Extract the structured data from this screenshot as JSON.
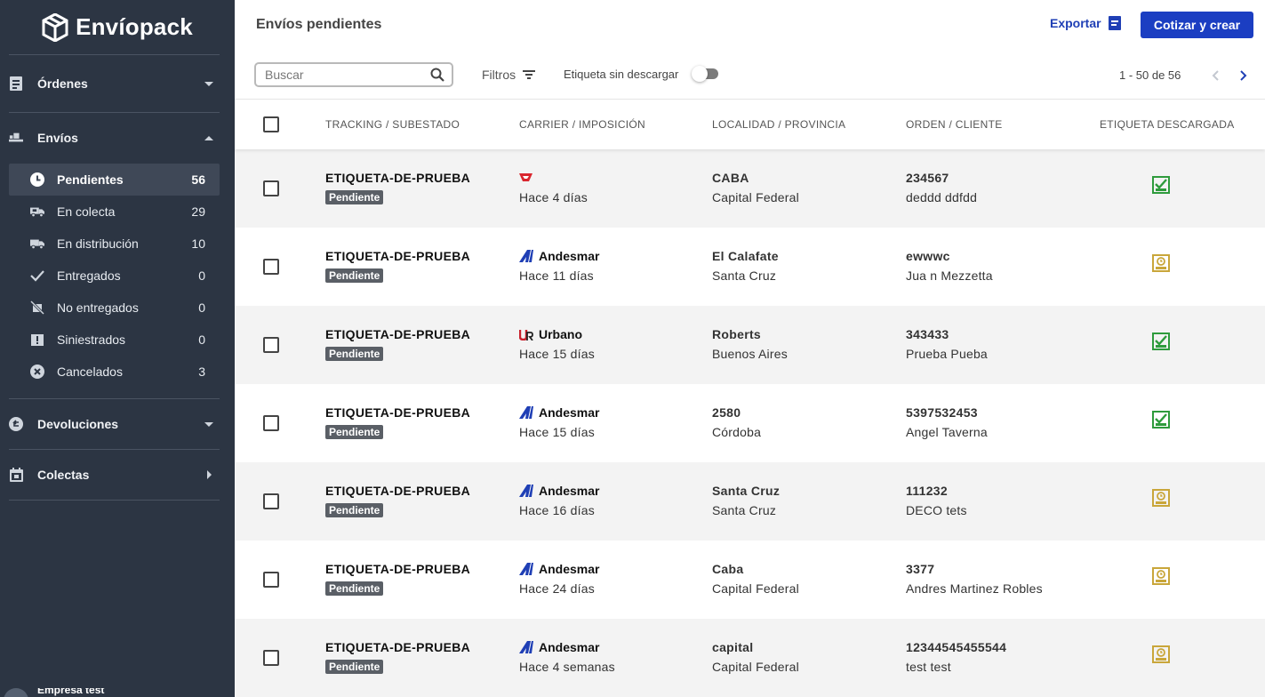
{
  "brand": {
    "name": "Envíopack"
  },
  "sidebar": {
    "ordenes": {
      "label": "Órdenes"
    },
    "envios": {
      "label": "Envíos",
      "items": [
        {
          "label": "Pendientes",
          "count": "56",
          "icon": "clock-icon"
        },
        {
          "label": "En colecta",
          "count": "29",
          "icon": "truck-pickup-icon"
        },
        {
          "label": "En distribución",
          "count": "10",
          "icon": "truck-icon"
        },
        {
          "label": "Entregados",
          "count": "0",
          "icon": "check-icon"
        },
        {
          "label": "No entregados",
          "count": "0",
          "icon": "box-cross-icon"
        },
        {
          "label": "Siniestrados",
          "count": "0",
          "icon": "damaged-box-icon"
        },
        {
          "label": "Cancelados",
          "count": "3",
          "icon": "cancel-icon"
        }
      ]
    },
    "devoluciones": {
      "label": "Devoluciones"
    },
    "colectas": {
      "label": "Colectas"
    },
    "company": {
      "name": "Empresa test"
    }
  },
  "header": {
    "title": "Envíos pendientes",
    "export_label": "Exportar",
    "create_label": "Cotizar y crear"
  },
  "toolbar": {
    "search_placeholder": "Buscar",
    "filters_label": "Filtros",
    "toggle_label": "Etiqueta sin descargar",
    "pagination": "1 - 50 de 56"
  },
  "table": {
    "columns": [
      "TRACKING / SUBESTADO",
      "CARRIER / IMPOSICIÓN",
      "LOCALIDAD / PROVINCIA",
      "ORDEN / CLIENTE",
      "ETIQUETA DESCARGADA"
    ],
    "rows": [
      {
        "tracking": "ETIQUETA-DE-PRUEBA",
        "status": "Pendiente",
        "carrier": "",
        "carrier_logo": "red-carrier-logo",
        "time": "Hace 4 días",
        "locality": "CABA",
        "province": "Capital Federal",
        "order": "234567",
        "client": "deddd ddfdd",
        "label_downloaded": true
      },
      {
        "tracking": "ETIQUETA-DE-PRUEBA",
        "status": "Pendiente",
        "carrier": "Andesmar",
        "carrier_logo": "andesmar-logo",
        "time": "Hace 11 días",
        "locality": "El Calafate",
        "province": "Santa Cruz",
        "order": "ewwwc",
        "client": "Jua n Mezzetta",
        "label_downloaded": false
      },
      {
        "tracking": "ETIQUETA-DE-PRUEBA",
        "status": "Pendiente",
        "carrier": "Urbano",
        "carrier_logo": "urbano-logo",
        "time": "Hace 15 días",
        "locality": "Roberts",
        "province": "Buenos Aires",
        "order": "343433",
        "client": "Prueba Pueba",
        "label_downloaded": true
      },
      {
        "tracking": "ETIQUETA-DE-PRUEBA",
        "status": "Pendiente",
        "carrier": "Andesmar",
        "carrier_logo": "andesmar-logo",
        "time": "Hace 15 días",
        "locality": "2580",
        "province": "Córdoba",
        "order": "5397532453",
        "client": "Angel Taverna",
        "label_downloaded": true
      },
      {
        "tracking": "ETIQUETA-DE-PRUEBA",
        "status": "Pendiente",
        "carrier": "Andesmar",
        "carrier_logo": "andesmar-logo",
        "time": "Hace 16 días",
        "locality": "Santa Cruz",
        "province": "Santa Cruz",
        "order": "111232",
        "client": "DECO tets",
        "label_downloaded": false
      },
      {
        "tracking": "ETIQUETA-DE-PRUEBA",
        "status": "Pendiente",
        "carrier": "Andesmar",
        "carrier_logo": "andesmar-logo",
        "time": "Hace 24 días",
        "locality": "Caba",
        "province": "Capital Federal",
        "order": "3377",
        "client": "Andres Martinez Robles",
        "label_downloaded": false
      },
      {
        "tracking": "ETIQUETA-DE-PRUEBA",
        "status": "Pendiente",
        "carrier": "Andesmar",
        "carrier_logo": "andesmar-logo",
        "time": "Hace 4 semanas",
        "locality": "capital",
        "province": "Capital Federal",
        "order": "12344545455544",
        "client": "test test",
        "label_downloaded": false
      }
    ]
  },
  "colors": {
    "sidebar_bg": "#2c3543",
    "primary": "#1b3ec2",
    "label_downloaded": "#2e9b3c",
    "label_pending": "#c9a63a",
    "andesmar": "#1f3fb5",
    "urbano": "#c8202c"
  }
}
